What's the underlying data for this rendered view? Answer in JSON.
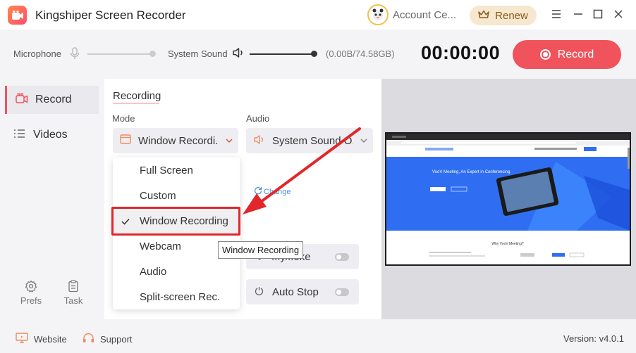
{
  "app": {
    "title": "Kingshiper Screen Recorder"
  },
  "titlebar": {
    "account_label": "Account Ce...",
    "renew_label": "Renew",
    "menu_icon": "hamburger-icon",
    "minimize_icon": "minimize-icon",
    "maximize_icon": "maximize-icon",
    "close_icon": "close-icon"
  },
  "toolbar": {
    "microphone_label": "Microphone",
    "microphone_level": 1.0,
    "system_sound_label": "System Sound",
    "system_sound_level": 1.0,
    "storage": "(0.00B/74.58GB)",
    "timer": "00:00:00",
    "record_label": "Record"
  },
  "sidebar": {
    "items": [
      {
        "label": "Record",
        "icon": "camera-icon",
        "active": true
      },
      {
        "label": "Videos",
        "icon": "list-icon",
        "active": false
      }
    ],
    "tools": [
      {
        "label": "Prefs",
        "icon": "gear-icon"
      },
      {
        "label": "Task",
        "icon": "clipboard-icon"
      }
    ]
  },
  "panel": {
    "section_title": "Recording",
    "mode_label": "Mode",
    "mode_value": "Window Recordi...",
    "audio_label": "Audio",
    "audio_value": "System Sound O...",
    "change_link": "Change",
    "option_rows": [
      {
        "label": "...y...oke",
        "icon": "cursor-icon",
        "enabled": false
      },
      {
        "label": "Auto Stop",
        "icon": "power-icon",
        "enabled": false
      }
    ]
  },
  "dropdown": {
    "items": [
      {
        "label": "Full Screen",
        "selected": false
      },
      {
        "label": "Custom",
        "selected": false
      },
      {
        "label": "Window Recording",
        "selected": true
      },
      {
        "label": "Webcam",
        "selected": false
      },
      {
        "label": "Audio",
        "selected": false
      },
      {
        "label": "Split-screen Rec.",
        "selected": false
      }
    ],
    "tooltip": "Window Recording"
  },
  "preview": {
    "hero_title": "VooV Meeting, An Expert in Conferencing",
    "section_heading": "Why VooV Meeting?"
  },
  "footer": {
    "website_label": "Website",
    "support_label": "Support",
    "version": "Version: v4.0.1"
  },
  "colors": {
    "accent": "#f0535c",
    "highlight": "#e2272b",
    "link": "#4a90e2",
    "preview_blue": "#2f6ef2"
  }
}
